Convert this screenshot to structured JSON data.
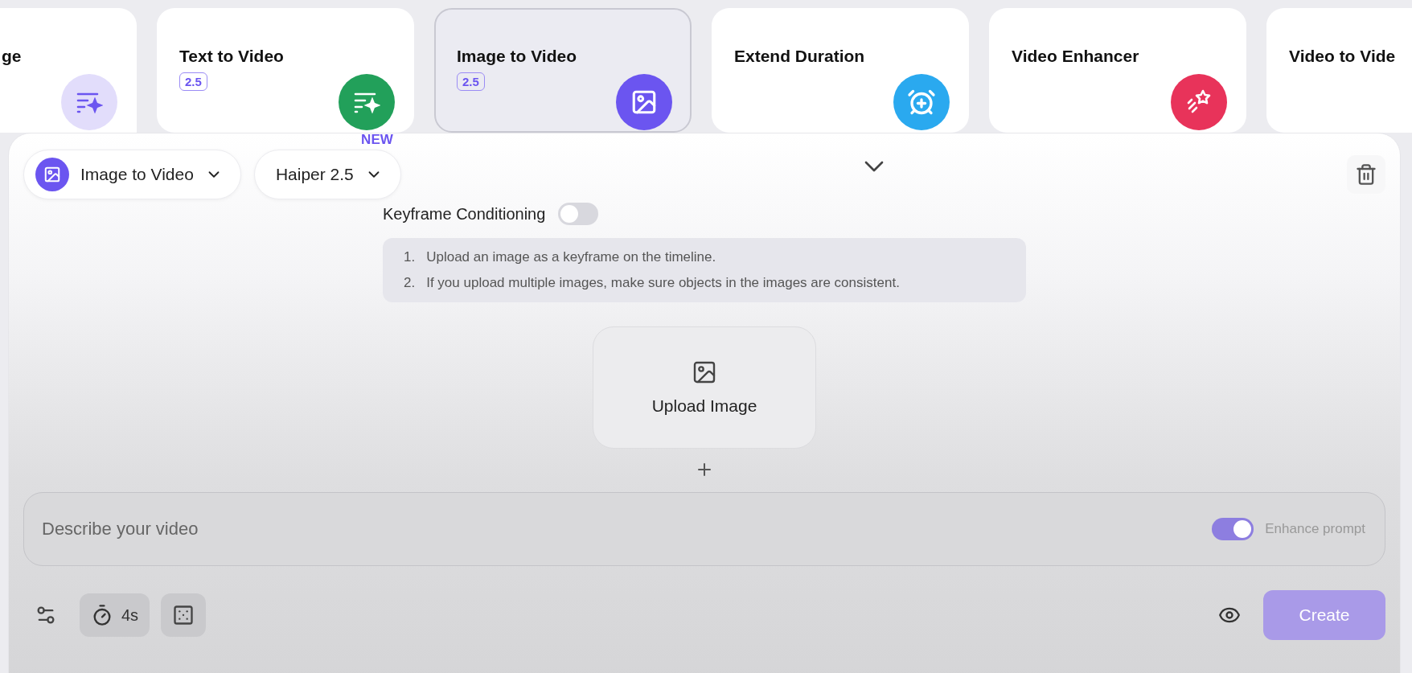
{
  "cards": [
    {
      "title": "ge",
      "kind": "text",
      "color": "#e2ddfb",
      "selected": false
    },
    {
      "title": "Text to Video",
      "badge": "2.5",
      "kind": "text",
      "color": "#22a05a",
      "selected": false
    },
    {
      "title": "Image to Video",
      "badge": "2.5",
      "kind": "image",
      "color": "#6b55f0",
      "selected": true
    },
    {
      "title": "Extend Duration",
      "kind": "extend",
      "color": "#2aa9ef",
      "selected": false
    },
    {
      "title": "Video Enhancer",
      "kind": "enhance",
      "color": "#e8335a",
      "selected": false
    },
    {
      "title": "Video to Vide",
      "selected": false
    }
  ],
  "panel": {
    "mode_selector": {
      "label": "Image to Video"
    },
    "model_selector": {
      "label": "Haiper 2.5",
      "badge": "NEW"
    },
    "keyframe_conditioning": {
      "label": "Keyframe Conditioning",
      "on": false
    },
    "instructions": [
      {
        "number": "1.",
        "text": "Upload an image as a keyframe on the timeline."
      },
      {
        "number": "2.",
        "text": "If you upload multiple images, make sure objects in the images are consistent."
      }
    ],
    "upload": {
      "label": "Upload Image"
    },
    "prompt": {
      "placeholder": "Describe your video",
      "enhance": {
        "label": "Enhance prompt",
        "on": true
      }
    },
    "toolbar": {
      "duration": "4s"
    },
    "create_button": {
      "label": "Create",
      "disabled": true
    }
  }
}
